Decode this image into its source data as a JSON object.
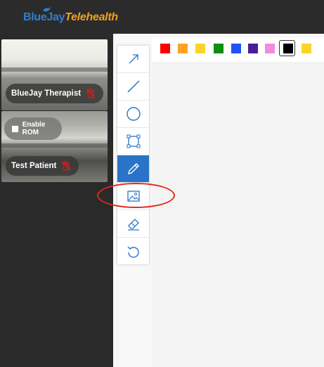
{
  "header": {
    "logo_brand": "BlueJay",
    "logo_product": "Telehealth"
  },
  "participants": [
    {
      "name": "BlueJay Therapist",
      "mic_icon": "muted-hand-icon"
    },
    {
      "name": "Test Patient",
      "mic_icon": "muted-hand-icon",
      "rom_label": "Enable ROM",
      "rom_checked": false
    }
  ],
  "colors": {
    "swatches": [
      "#ff0000",
      "#ffa125",
      "#fbd32b",
      "#0f8d12",
      "#1e54f7",
      "#4b1e94",
      "#f08be0",
      "#000000",
      "#fcd32b"
    ],
    "selected": "#000000",
    "accent": "#2a73c8",
    "highlight": "#e12a1a"
  },
  "tools": [
    {
      "name": "arrow",
      "icon": "arrow-icon",
      "active": false
    },
    {
      "name": "line",
      "icon": "line-icon",
      "active": false
    },
    {
      "name": "circle",
      "icon": "circle-icon",
      "active": false
    },
    {
      "name": "rectangle",
      "icon": "rectangle-icon",
      "active": false
    },
    {
      "name": "pencil",
      "icon": "pencil-icon",
      "active": true
    },
    {
      "name": "image",
      "icon": "image-icon",
      "active": false
    },
    {
      "name": "eraser",
      "icon": "eraser-icon",
      "active": false
    },
    {
      "name": "undo",
      "icon": "undo-icon",
      "active": false
    }
  ]
}
